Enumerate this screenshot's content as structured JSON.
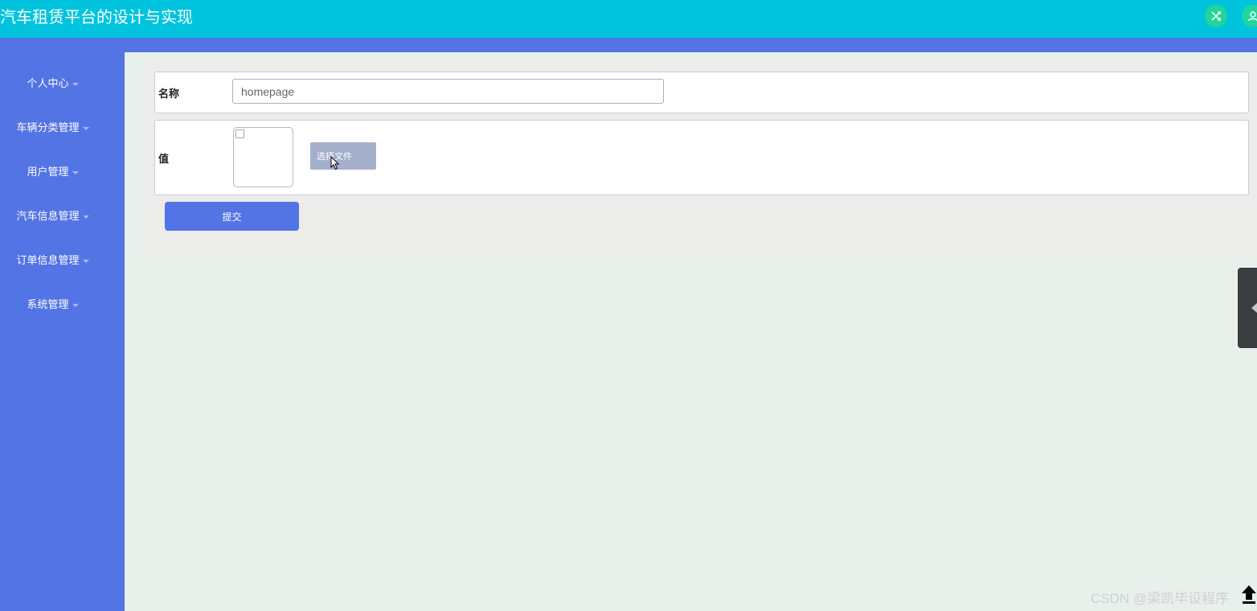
{
  "app": {
    "title": "汽车租赁平台的设计与实现",
    "colors": {
      "header": "#00c4de",
      "sidebar": "#5374e4",
      "accent": "#22d59a"
    }
  },
  "header": {
    "icons": [
      "shuffle-icon",
      "user-icon"
    ]
  },
  "sidebar": {
    "items": [
      {
        "label": "个人中心",
        "icon": "caret-down-icon"
      },
      {
        "label": "车辆分类管理",
        "icon": "caret-down-icon"
      },
      {
        "label": "用户管理",
        "icon": "caret-down-icon"
      },
      {
        "label": "汽车信息管理",
        "icon": "caret-down-icon"
      },
      {
        "label": "订单信息管理",
        "icon": "caret-down-icon"
      },
      {
        "label": "系统管理",
        "icon": "caret-down-icon"
      }
    ]
  },
  "form": {
    "name_label": "名称",
    "name_value": "homepage",
    "value_label": "值",
    "choose_file_label": "选择文件",
    "submit_label": "提交"
  },
  "footer": {
    "watermark": "CSDN @梁凯毕设程序"
  }
}
